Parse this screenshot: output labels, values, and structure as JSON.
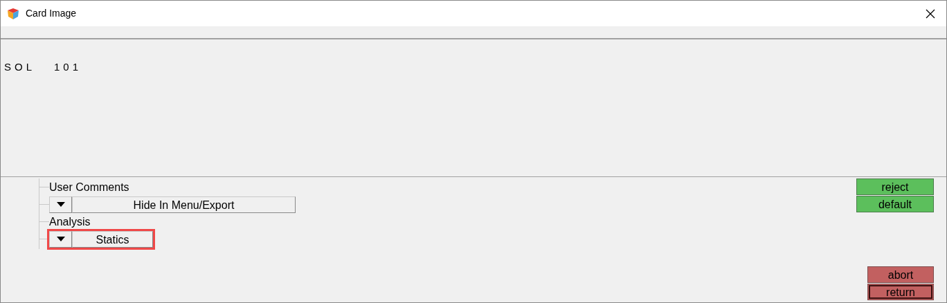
{
  "window": {
    "title": "Card Image"
  },
  "card_text": "SOL   101",
  "options": [
    {
      "label": "User Comments",
      "value": "Hide In Menu/Export",
      "highlighted": false
    },
    {
      "label": "Analysis",
      "value": "Statics",
      "highlighted": true
    }
  ],
  "top_buttons": [
    {
      "label": "reject",
      "color": "#5cbf5c",
      "focused": false
    },
    {
      "label": "default",
      "color": "#5cbf5c",
      "focused": false
    }
  ],
  "bottom_buttons": [
    {
      "label": "abort",
      "color": "#c26060",
      "focused": false
    },
    {
      "label": "return",
      "color": "#c26060",
      "focused": true
    }
  ]
}
